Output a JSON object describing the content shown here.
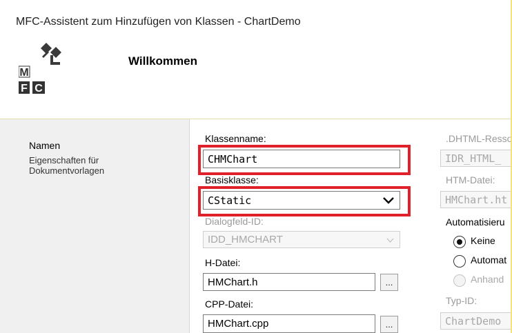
{
  "window": {
    "title": "MFC-Assistent zum Hinzufügen von Klassen - ChartDemo"
  },
  "header": {
    "heading": "Willkommen",
    "logo_letters": [
      "M",
      "F",
      "C"
    ]
  },
  "sidebar": {
    "items": [
      {
        "label": "Namen",
        "active": true
      },
      {
        "label": "Eigenschaften für Dokumentvorlagen",
        "active": false
      }
    ]
  },
  "form": {
    "class_name": {
      "label": "Klassenname:",
      "value": "CHMChart"
    },
    "base_class": {
      "label": "Basisklasse:",
      "value": "CStatic"
    },
    "dialog_id": {
      "label": "Dialogfeld-ID:",
      "value": "IDD_HMCHART",
      "enabled": false
    },
    "h_file": {
      "label": "H-Datei:",
      "value": "HMChart.h",
      "browse": "..."
    },
    "cpp_file": {
      "label": "CPP-Datei:",
      "value": "HMChart.cpp",
      "browse": "..."
    }
  },
  "right": {
    "dhtml_resource": {
      "label": ".DHTML-Resso",
      "value": "IDR_HTML_"
    },
    "htm_file": {
      "label": "HTM-Datei:",
      "value": "HMChart.ht"
    },
    "automation": {
      "label": "Automatisieru",
      "options": [
        {
          "label": "Keine",
          "selected": true,
          "enabled": true
        },
        {
          "label": "Automat",
          "selected": false,
          "enabled": true
        },
        {
          "label": "Anhand",
          "selected": false,
          "enabled": false
        }
      ]
    },
    "type_id": {
      "label": "Typ-ID:",
      "value": "ChartDemo"
    }
  },
  "colors": {
    "highlight": "#e0202a",
    "header_border": "#f4e37a",
    "sidebar_bg": "#f0f0f0"
  }
}
